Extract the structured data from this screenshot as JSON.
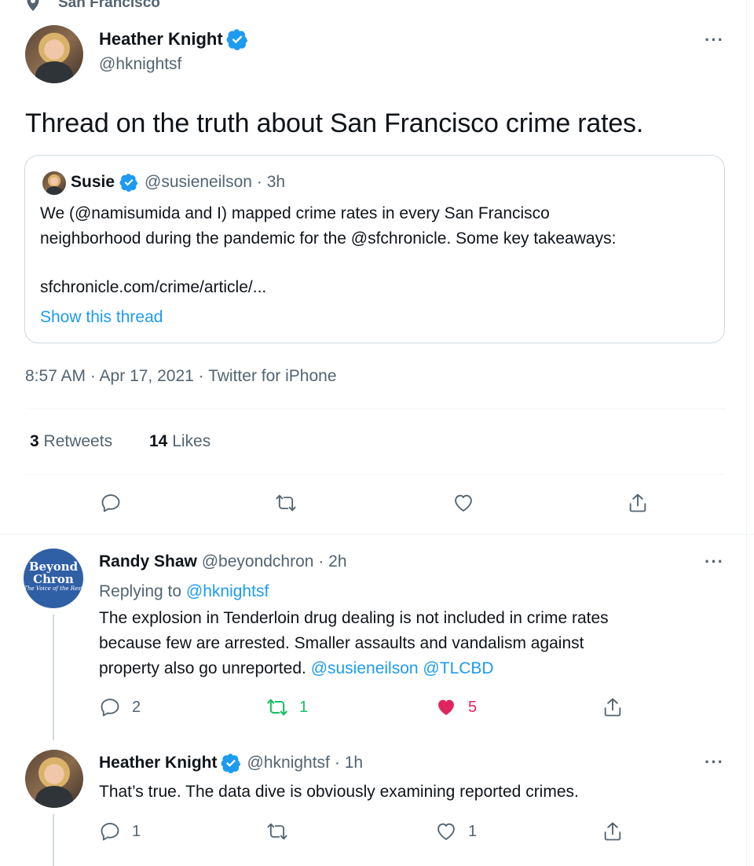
{
  "header": {
    "location": "San Francisco"
  },
  "main_tweet": {
    "name": "Heather Knight",
    "handle": "@hknightsf",
    "text": "Thread on the truth about San Francisco crime rates.",
    "quote": {
      "name": "Susie",
      "handle": "@susieneilson",
      "time": "· 3h",
      "text_line1": "We (@namisumida and I) mapped crime rates in every San Francisco",
      "text_line2": "neighborhood during the pandemic for the @sfchronicle. Some key takeaways:",
      "link": "sfchronicle.com/crime/article/...",
      "show_thread": "Show this thread"
    },
    "meta": "8:57 AM · Apr 17, 2021 · Twitter for iPhone",
    "retweets_count": "3",
    "retweets_label": "Retweets",
    "likes_count": "14",
    "likes_label": "Likes"
  },
  "reply1": {
    "avatar_text1": "Beyond",
    "avatar_text2": "Chron",
    "avatar_text3": "The Voice of the Rest",
    "name": "Randy Shaw",
    "handle": "@beyondchron",
    "time": "· 2h",
    "replying_prefix": "Replying to",
    "replying_handle": "@hknightsf",
    "text_line1": "The explosion in Tenderloin drug dealing is not included in crime rates",
    "text_line2": "because few are arrested. Smaller assaults and vandalism against",
    "text_line3": "property also go unreported.",
    "mention1": "@susieneilson",
    "mention2": "@TLCBD",
    "replies": "2",
    "retweets": "1",
    "likes": "5"
  },
  "reply2": {
    "name": "Heather Knight",
    "handle": "@hknightsf",
    "time": "· 1h",
    "text": "That’s true. The data dive is obviously examining reported crimes.",
    "replies": "1",
    "likes": "1"
  },
  "colors": {
    "accent": "#1d9bf0",
    "retweet_green": "#17bf63",
    "like_pink": "#e0245e",
    "gray": "#536471"
  }
}
